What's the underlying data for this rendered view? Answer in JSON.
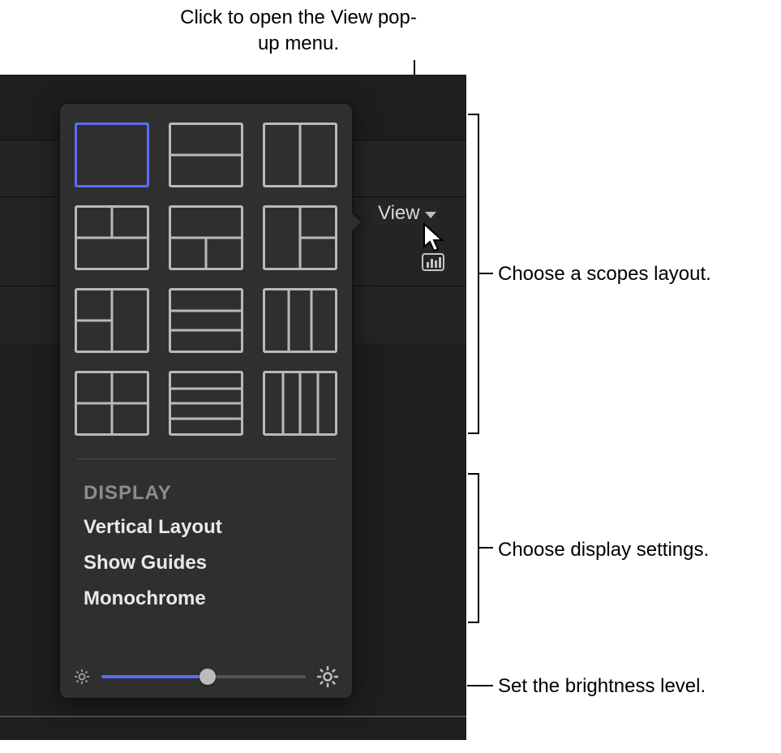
{
  "callouts": {
    "top": "Click to open the View pop-up menu.",
    "layouts": "Choose a scopes layout.",
    "display": "Choose display settings.",
    "brightness": "Set the brightness level."
  },
  "view_button": {
    "label": "View"
  },
  "popover": {
    "section_title": "DISPLAY",
    "items": [
      {
        "label": "Vertical Layout"
      },
      {
        "label": "Show Guides"
      },
      {
        "label": "Monochrome"
      }
    ],
    "layout_options": [
      {
        "name": "layout-1x1",
        "selected": true
      },
      {
        "name": "layout-1over1"
      },
      {
        "name": "layout-2cols"
      },
      {
        "name": "layout-2over1"
      },
      {
        "name": "layout-1over2"
      },
      {
        "name": "layout-2x2-offset-r"
      },
      {
        "name": "layout-2left-1right"
      },
      {
        "name": "layout-1over3"
      },
      {
        "name": "layout-3cols"
      },
      {
        "name": "layout-2x2"
      },
      {
        "name": "layout-4rows"
      },
      {
        "name": "layout-4cols"
      }
    ],
    "brightness": {
      "value_pct": 52
    }
  },
  "colors": {
    "accent": "#5a6bff",
    "panel": "#2f2f2f"
  }
}
